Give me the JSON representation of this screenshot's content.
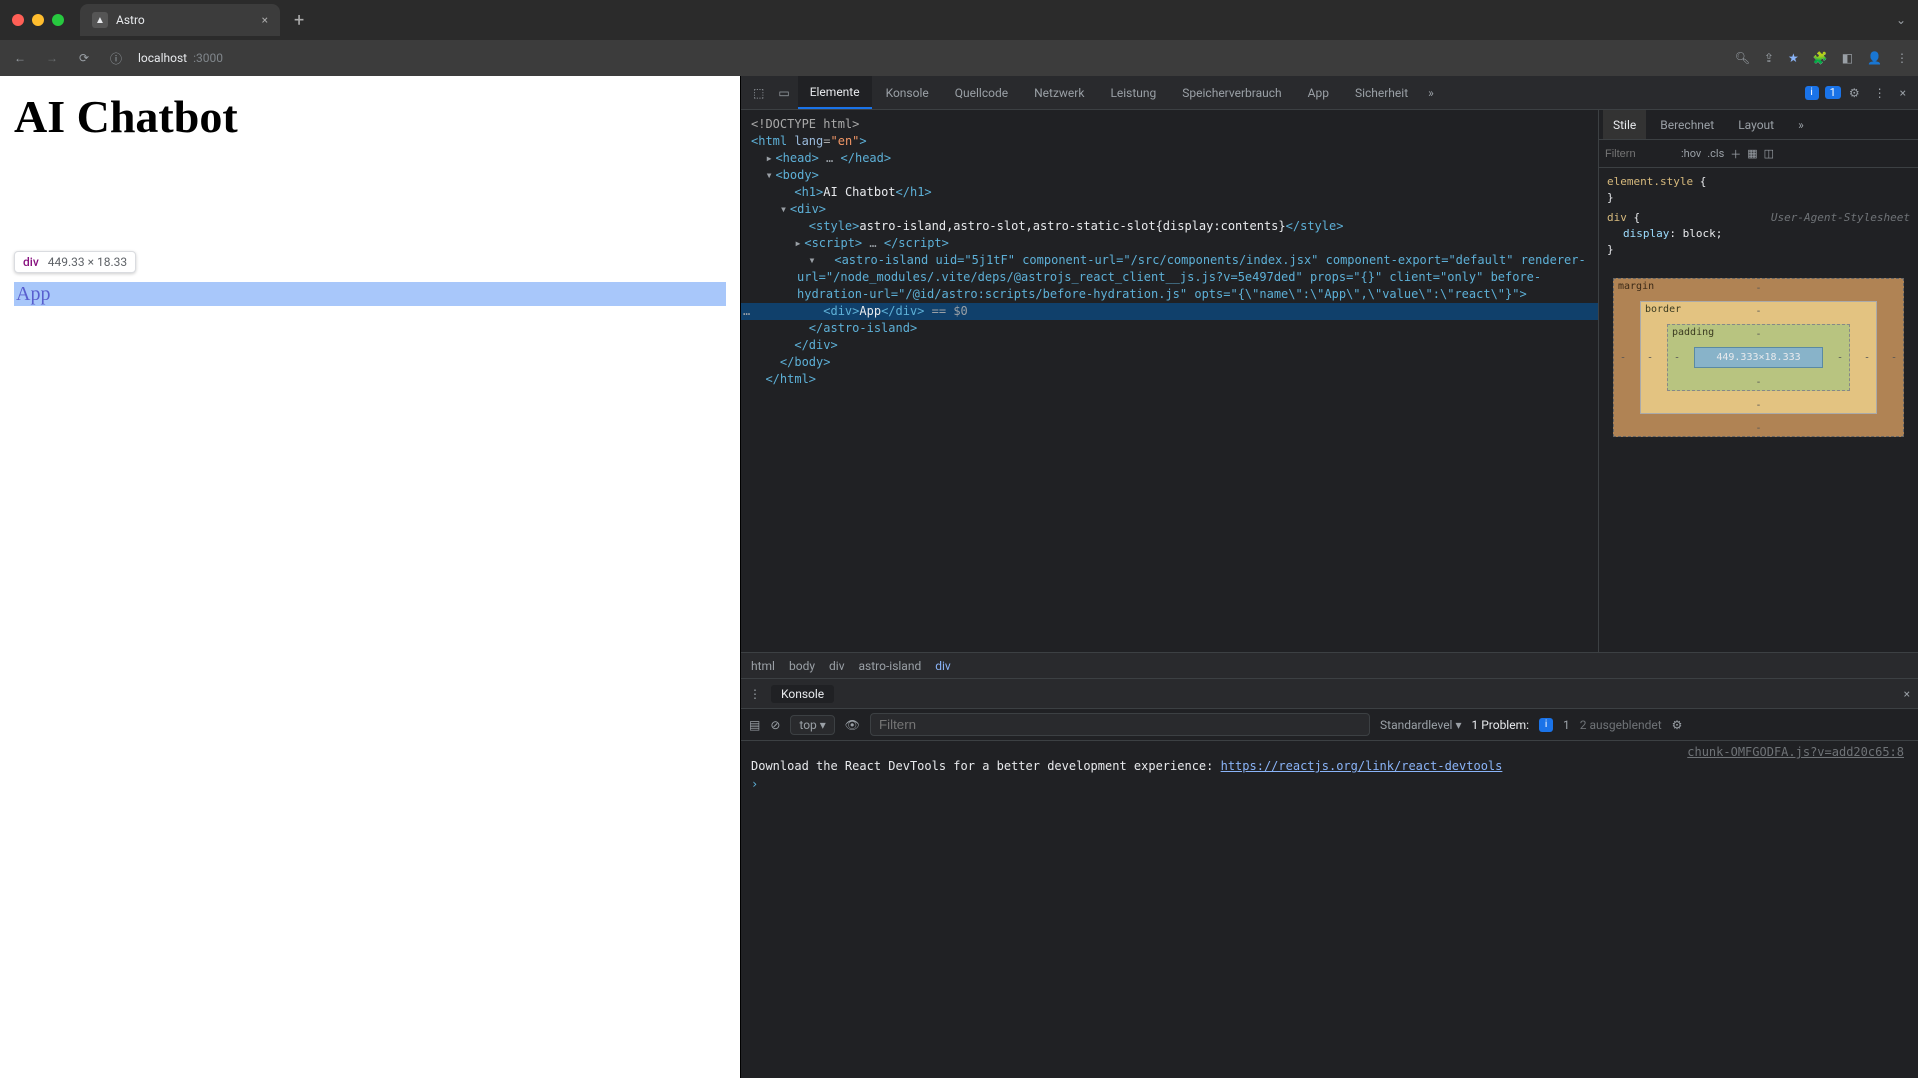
{
  "browser": {
    "tab_title": "Astro",
    "url_host": "localhost",
    "url_port": ":3000"
  },
  "page": {
    "heading": "AI Chatbot",
    "highlighted_text": "App",
    "tooltip_tag": "div",
    "tooltip_dims": "449.33 × 18.33"
  },
  "devtools": {
    "tabs": [
      "Elemente",
      "Konsole",
      "Quellcode",
      "Netzwerk",
      "Leistung",
      "Speicherverbrauch",
      "App",
      "Sicherheit"
    ],
    "active_tab": "Elemente",
    "issues_count": "1",
    "breadcrumb": [
      "html",
      "body",
      "div",
      "astro-island",
      "div"
    ],
    "dom": {
      "l1": "<!DOCTYPE html>",
      "l2_open": "<html ",
      "l2_attr_n": "lang",
      "l2_attr_v": "\"en\"",
      "l2_close": ">",
      "l3": "<head>",
      "l3_ell": "…",
      "l3_end": "</head>",
      "l4": "<body>",
      "l5a": "<h1>",
      "l5t": "AI Chatbot",
      "l5b": "</h1>",
      "l6": "<div>",
      "l7a": "<style>",
      "l7t": "astro-island,astro-slot,astro-static-slot{display:contents}",
      "l7b": "</style>",
      "l8a": "<script>",
      "l8_ell": "…",
      "l8b": "</script>",
      "l9": "<astro-island uid=\"5j1tF\" component-url=\"/src/components/index.jsx\" component-export=\"default\" renderer-url=\"/node_modules/.vite/deps/@astrojs_react_client__js.js?v=5e497ded\" props=\"{}\" client=\"only\" before-hydration-url=\"/@id/astro:scripts/before-hydration.js\" opts=\"{\\\"name\\\":\\\"App\\\",\\\"value\\\":\\\"react\\\"}\">",
      "sel_a": "<div>",
      "sel_t": "App",
      "sel_b": "</div>",
      "sel_eq": " == $0",
      "l11": "</astro-island>",
      "l12": "</div>",
      "l13": "</body>",
      "l14": "</html>"
    }
  },
  "styles": {
    "tabs": [
      "Stile",
      "Berechnet",
      "Layout"
    ],
    "filter_placeholder": "Filtern",
    "hov": ":hov",
    "cls": ".cls",
    "rule1_sel": "element.style",
    "rule2_sel": "div",
    "rule2_src": "User-Agent-Stylesheet",
    "rule2_prop": "display",
    "rule2_val": "block",
    "box_content": "449.333×18.333",
    "lbl_margin": "margin",
    "lbl_border": "border",
    "lbl_padding": "padding"
  },
  "console": {
    "drawer_title": "Konsole",
    "top": "top",
    "filter_placeholder": "Filtern",
    "level": "Standardlevel",
    "problem_label": "1 Problem:",
    "problem_count": "1",
    "hidden": "2 ausgeblendet",
    "source": "chunk-OMFGODFA.js?v=add20c65:8",
    "msg_prefix": "Download the React DevTools for a better development experience: ",
    "msg_link": "https://reactjs.org/link/react-devtools"
  }
}
